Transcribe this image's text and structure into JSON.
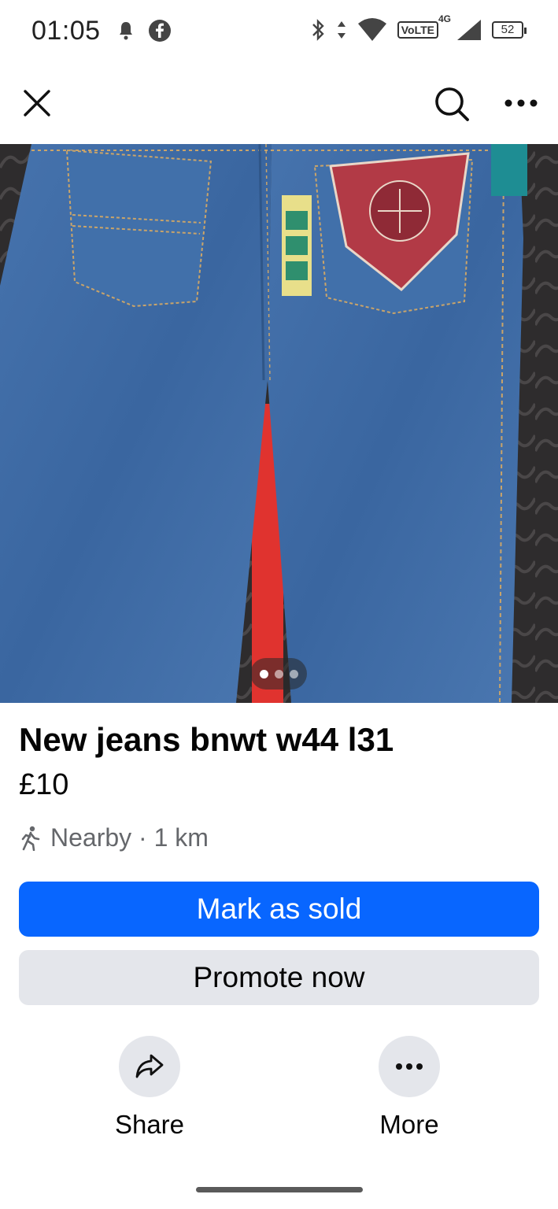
{
  "status_bar": {
    "time": "01:05",
    "left_icons": [
      "notification-bell-icon",
      "facebook-icon"
    ],
    "right_icons": [
      "bluetooth-icon",
      "data-arrows-icon",
      "wifi-icon",
      "volte-icon",
      "signal-icon",
      "battery-icon"
    ],
    "volte_label": "VoLTE",
    "network_label": "4G",
    "battery_level": "52"
  },
  "top_nav": {
    "close_icon": "close-icon",
    "search_icon": "search-icon",
    "more_icon": "more-horizontal-icon"
  },
  "hero": {
    "pager_count": 3,
    "pager_active_index": 0
  },
  "listing": {
    "title": "New jeans bnwt w44 l31",
    "price": "£10",
    "location_icon": "walking-person-icon",
    "location_text": "Nearby · 1 km"
  },
  "buttons": {
    "mark_sold": "Mark as sold",
    "promote": "Promote now"
  },
  "actions": {
    "share_label": "Share",
    "more_label": "More"
  },
  "colors": {
    "primary": "#0866ff",
    "secondary_bg": "#e4e6eb",
    "muted_text": "#65676b",
    "denim": "#3c6aa5"
  }
}
